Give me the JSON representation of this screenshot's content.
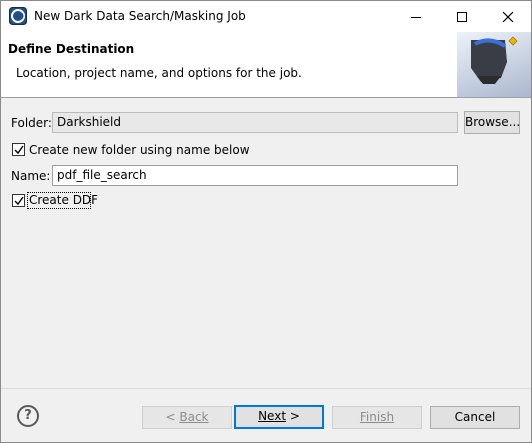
{
  "window": {
    "title": "New Dark Data Search/Masking Job"
  },
  "header": {
    "title": "Define Destination",
    "description": "Location, project name, and options for the job."
  },
  "form": {
    "folder_label": "Folder:",
    "folder_value": "Darkshield",
    "browse_label": "Browse...",
    "create_folder_label": "Create new folder using name below",
    "create_folder_checked": true,
    "name_label": "Name:",
    "name_value": "pdf_file_search",
    "create_ddf_label": "Create DDF",
    "create_ddf_checked": true
  },
  "footer": {
    "help_glyph": "?",
    "back_arrow": "< ",
    "back_label": "Back",
    "next_label": "Next",
    "next_arrow": " >",
    "finish_label": "Finish",
    "cancel_label": "Cancel"
  },
  "icons": {
    "app": "eclipse-app-icon",
    "minimize": "minimize-icon",
    "maximize": "maximize-icon",
    "close": "close-icon",
    "help": "help-icon",
    "wizard_banner": "wizard-banner-icon"
  },
  "colors": {
    "accent": "#0078d7",
    "header_bg": "#ffffff",
    "body_bg": "#f0f0f0"
  }
}
